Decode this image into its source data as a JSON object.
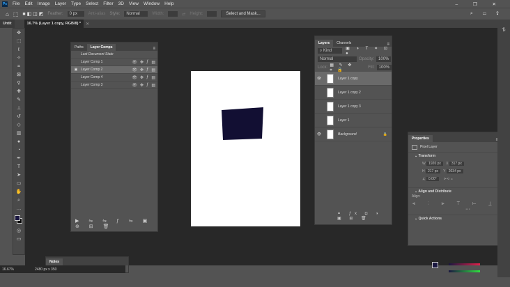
{
  "menu": [
    "File",
    "Edit",
    "Image",
    "Layer",
    "Type",
    "Select",
    "Filter",
    "3D",
    "View",
    "Window",
    "Help"
  ],
  "options": {
    "feather_label": "Feather:",
    "feather_value": "0 px",
    "antialias": "Anti-alias",
    "style_label": "Style:",
    "style_value": "Normal",
    "width_label": "Width:",
    "height_label": "Height:",
    "select_mask": "Select and Mask..."
  },
  "tabs": {
    "first": "Untit",
    "doc": "16.7% (Layer 1 copy, RGB/8) *"
  },
  "layer_comps": {
    "tabs": [
      "Paths",
      "Layer Comps"
    ],
    "last_state": "Last Document State",
    "items": [
      "Layer Comp 1",
      "Layer Comp 2",
      "Layer Comp 4",
      "Layer Comp 3"
    ],
    "selected": 1
  },
  "layers": {
    "tabs": [
      "Layers",
      "Channels"
    ],
    "kind": "Kind",
    "blend": "Normal",
    "opacity_label": "Opacity:",
    "opacity": "100%",
    "lock_label": "Lock:",
    "fill_label": "Fill:",
    "fill": "100%",
    "items": [
      {
        "name": "Layer 1 copy",
        "visible": true
      },
      {
        "name": "Layer 1 copy 2",
        "visible": false
      },
      {
        "name": "Layer 1 copy 3",
        "visible": false
      },
      {
        "name": "Layer 1",
        "visible": false
      },
      {
        "name": "Background",
        "visible": true
      }
    ]
  },
  "properties": {
    "title": "Properties",
    "type": "Pixel Layer",
    "transform": "Transform",
    "w": "1920 px",
    "x": "317 px",
    "h": "217 px",
    "y": "2034 px",
    "angle": "0.00°",
    "align": "Align and Distribute",
    "align_label": "Align:",
    "quick": "Quick Actions"
  },
  "notes": "Notes",
  "status": {
    "zoom": "16.67%",
    "size": "2480 px x 350"
  },
  "colors": {
    "quad": "#120f33",
    "fg": "#1a1740"
  }
}
